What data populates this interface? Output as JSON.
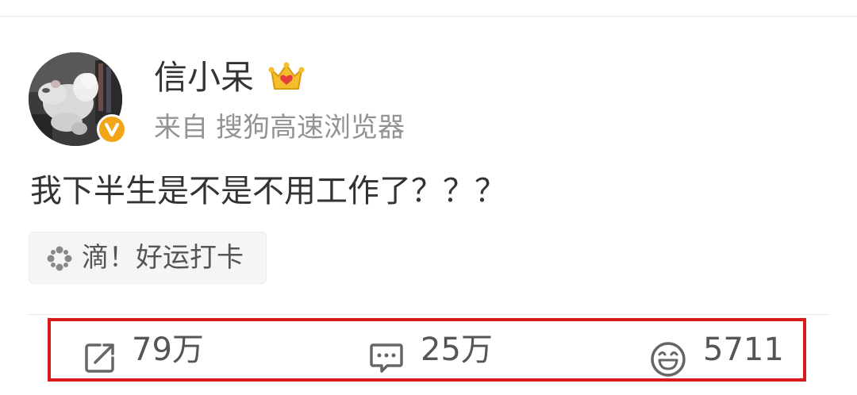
{
  "post": {
    "author": {
      "name": "信小呆",
      "avatar_icon": "white-rat-photo",
      "verified_icon": "verified-v-badge-icon",
      "member_icon": "crown-icon"
    },
    "source_prefix": "来自",
    "source_app": "搜狗高速浏览器",
    "text": "我下半生是不是不用工作了？？？",
    "checkin": {
      "icon": "sparkle-icon",
      "label": "滴！好运打卡"
    },
    "actions": {
      "repost": {
        "icon": "repost-icon",
        "count": "79万"
      },
      "comment": {
        "icon": "comment-icon",
        "count": "25万"
      },
      "like": {
        "icon": "smile-like-icon",
        "count": "5711"
      }
    }
  },
  "colors": {
    "highlight_box": "#d91a1a",
    "badge_orange": "#f2a516",
    "secondary_text": "#939393",
    "primary_text": "#333333"
  }
}
